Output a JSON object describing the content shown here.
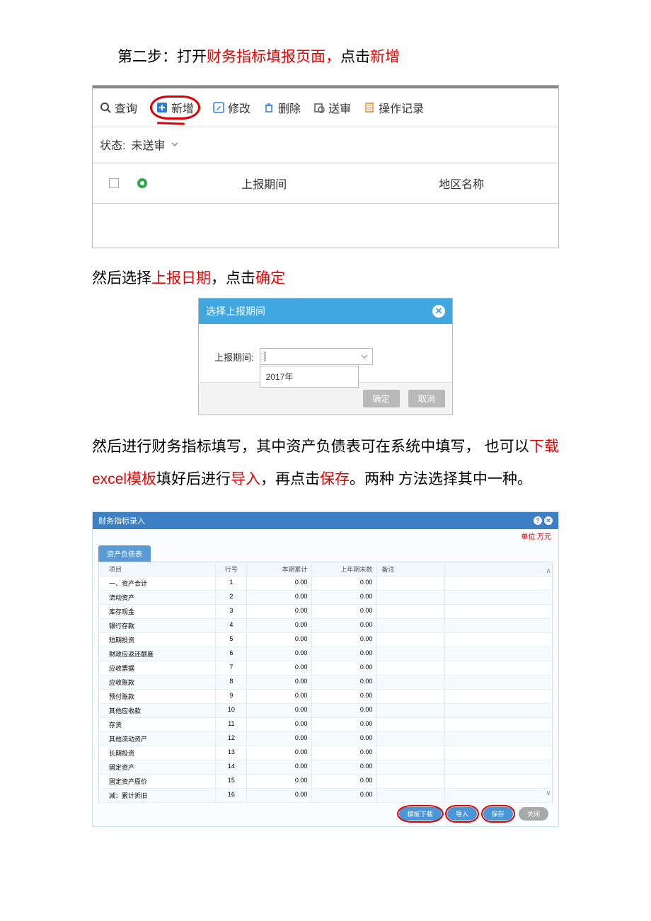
{
  "instr1": {
    "prefix": "第二步：打开",
    "red1": "财务指标填报页面，",
    "mid": "点击",
    "red2": "新增"
  },
  "toolbar": {
    "query": "查询",
    "add": "新增",
    "edit": "修改",
    "delete": "删除",
    "submit": "送审",
    "log": "操作记录"
  },
  "filter": {
    "label": "状态:",
    "value": "未送审"
  },
  "gridHead": {
    "period": "上报期间",
    "region": "地区名称"
  },
  "instr2": {
    "p1": "然后选择",
    "red1": "上报日期",
    "p2": "，点击",
    "red2": "确定"
  },
  "dialog": {
    "title": "选择上报期间",
    "label": "上报期间:",
    "option": "2017年",
    "ok": "确定",
    "cancel": "取消"
  },
  "para3": {
    "t1": "然后进行财务指标填写，其中资产负债表可在系统中填写，  也可以",
    "r1": "下载excel模板",
    "t2": "填好后进行",
    "r2": "导入",
    "t3": "，再点击",
    "r3": "保存",
    "t4": "。两种  方法选择其中一种。"
  },
  "win": {
    "title": "财务指标录入",
    "unit": "单位:万元",
    "tab": "资产负债表",
    "headers": {
      "name": "项目",
      "idx": "行号",
      "v1": "本期累计",
      "v2": "上年期末数",
      "note": "备注"
    },
    "rows": [
      {
        "name": "一、资产合计",
        "idx": "1",
        "v1": "0.00",
        "v2": "0.00"
      },
      {
        "name": "流动资产",
        "idx": "2",
        "v1": "0.00",
        "v2": "0.00"
      },
      {
        "name": "  库存现金",
        "idx": "3",
        "v1": "0.00",
        "v2": "0.00"
      },
      {
        "name": "  银行存款",
        "idx": "4",
        "v1": "0.00",
        "v2": "0.00"
      },
      {
        "name": "  短期投资",
        "idx": "5",
        "v1": "0.00",
        "v2": "0.00"
      },
      {
        "name": "  财政应返还额度",
        "idx": "6",
        "v1": "0.00",
        "v2": "0.00"
      },
      {
        "name": "  应收票据",
        "idx": "7",
        "v1": "0.00",
        "v2": "0.00"
      },
      {
        "name": "  应收账款",
        "idx": "8",
        "v1": "0.00",
        "v2": "0.00"
      },
      {
        "name": "  预付账款",
        "idx": "9",
        "v1": "0.00",
        "v2": "0.00"
      },
      {
        "name": "  其他应收款",
        "idx": "10",
        "v1": "0.00",
        "v2": "0.00"
      },
      {
        "name": "  存货",
        "idx": "11",
        "v1": "0.00",
        "v2": "0.00"
      },
      {
        "name": "  其他流动资产",
        "idx": "12",
        "v1": "0.00",
        "v2": "0.00"
      },
      {
        "name": "长期投资",
        "idx": "13",
        "v1": "0.00",
        "v2": "0.00"
      },
      {
        "name": "固定资产",
        "idx": "14",
        "v1": "0.00",
        "v2": "0.00"
      },
      {
        "name": "  固定资产原价",
        "idx": "15",
        "v1": "0.00",
        "v2": "0.00"
      },
      {
        "name": "  减：累计折旧",
        "idx": "16",
        "v1": "0.00",
        "v2": "0.00"
      }
    ],
    "btns": {
      "download": "模板下载",
      "import": "导入",
      "save": "保存",
      "close": "关闭"
    }
  }
}
